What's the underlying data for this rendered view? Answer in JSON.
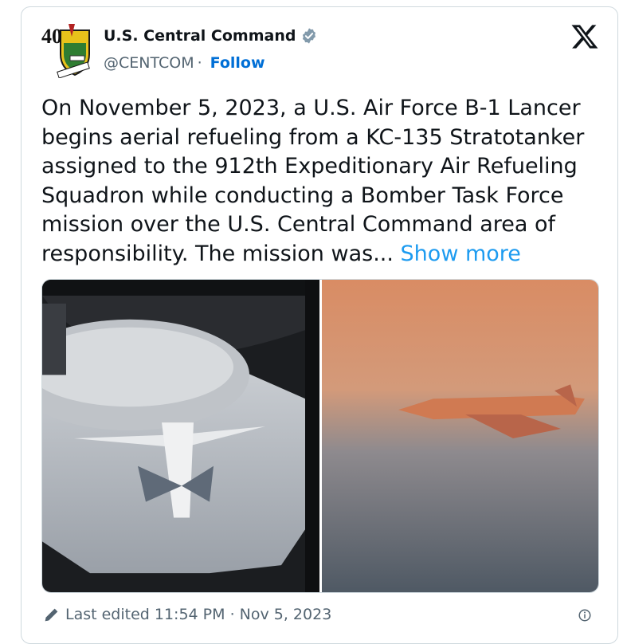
{
  "author": {
    "display_name": "U.S. Central Command",
    "handle": "@CENTCOM",
    "separator": "·",
    "follow_label": "Follow",
    "avatar_number": "40"
  },
  "tweet": {
    "text": "On November 5, 2023, a U.S. Air Force B-1 Lancer begins aerial refueling from a KC-135 Stratotanker assigned to the 912th Expeditionary Air Refueling Squadron while conducting a Bomber Task Force mission over the U.S. Central Command area of responsibility. The mission was...",
    "show_more_label": "Show more"
  },
  "footer": {
    "edited_label": "Last edited 11:54 PM · Nov 5, 2023"
  },
  "icons": {
    "verified": "verified-badge-icon",
    "x": "x-logo-icon",
    "pencil": "pencil-icon",
    "info": "info-icon"
  },
  "colors": {
    "link": "#006fd6",
    "show_more": "#1d9bf0",
    "secondary_text": "#536471",
    "border": "#cfd9de"
  }
}
